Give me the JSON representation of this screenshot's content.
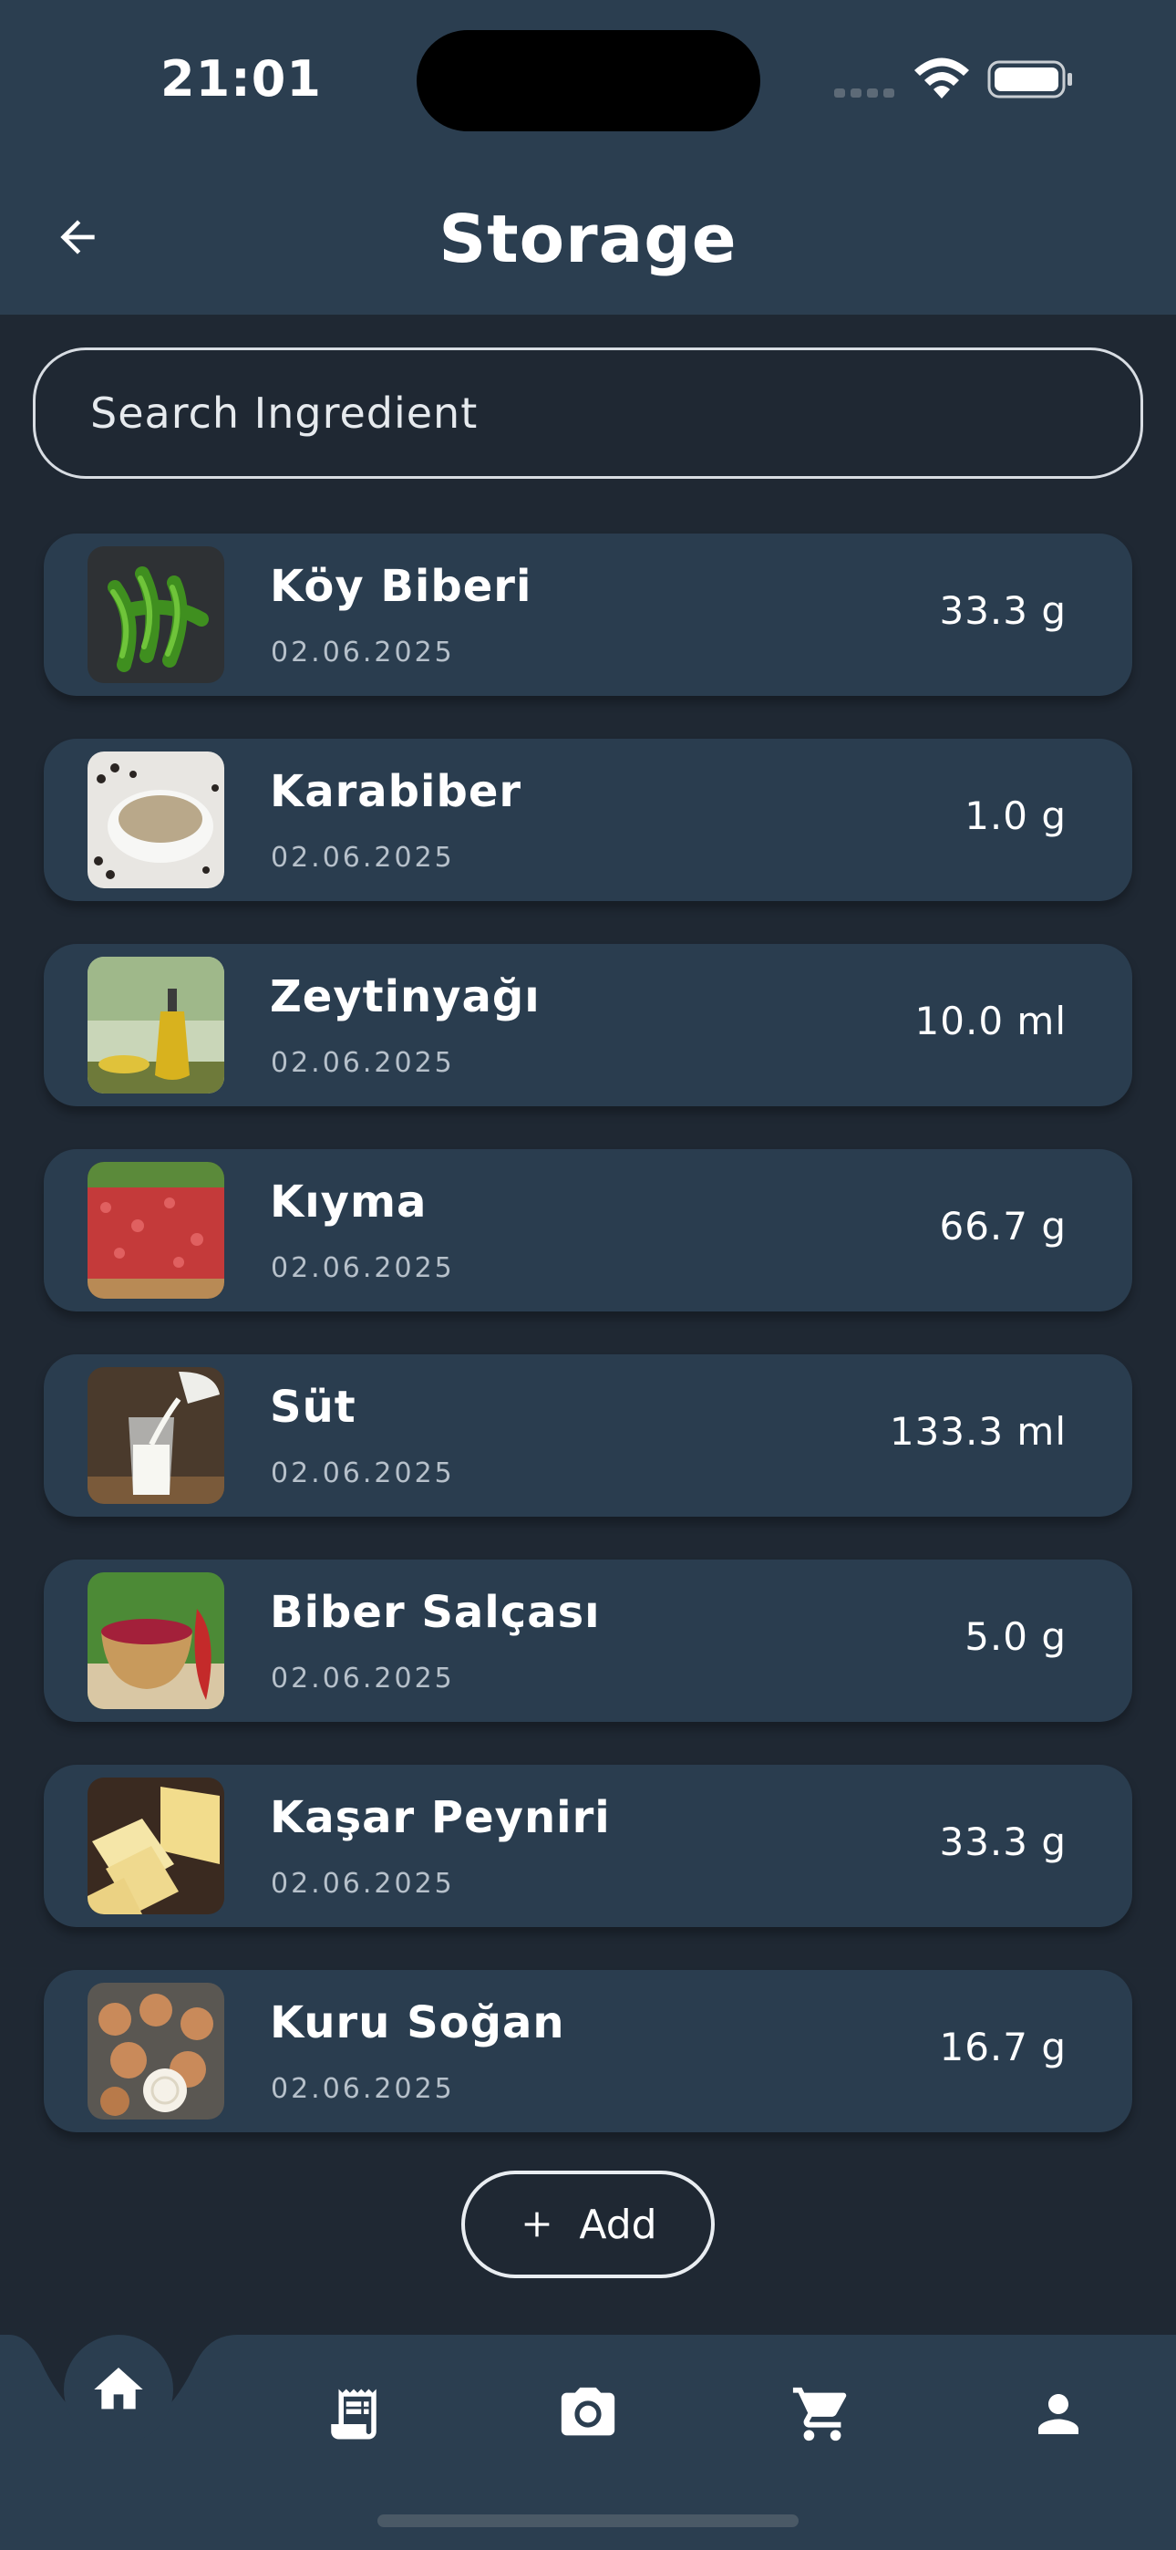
{
  "status_bar": {
    "time": "21:01"
  },
  "header": {
    "title": "Storage",
    "back_icon": "arrow-left-icon"
  },
  "search": {
    "placeholder": "Search Ingredient",
    "value": ""
  },
  "ingredients": [
    {
      "name": "Köy Biberi",
      "date": "02.06.2025",
      "quantity": "33.3 g",
      "image": "green-peppers"
    },
    {
      "name": "Karabiber",
      "date": "02.06.2025",
      "quantity": "1.0 g",
      "image": "black-pepper"
    },
    {
      "name": "Zeytinyağı",
      "date": "02.06.2025",
      "quantity": "10.0 ml",
      "image": "olive-oil"
    },
    {
      "name": "Kıyma",
      "date": "02.06.2025",
      "quantity": "66.7 g",
      "image": "ground-meat"
    },
    {
      "name": "Süt",
      "date": "02.06.2025",
      "quantity": "133.3 ml",
      "image": "milk"
    },
    {
      "name": "Biber Salçası",
      "date": "02.06.2025",
      "quantity": "5.0 g",
      "image": "pepper-paste"
    },
    {
      "name": "Kaşar Peyniri",
      "date": "02.06.2025",
      "quantity": "33.3 g",
      "image": "cheese"
    },
    {
      "name": "Kuru Soğan",
      "date": "02.06.2025",
      "quantity": "16.7 g",
      "image": "onions"
    }
  ],
  "add_button": {
    "label": "Add",
    "icon": "plus-icon"
  },
  "bottom_nav": [
    {
      "icon": "home-icon",
      "active": true
    },
    {
      "icon": "receipt-icon",
      "active": false
    },
    {
      "icon": "camera-icon",
      "active": false
    },
    {
      "icon": "cart-icon",
      "active": false
    },
    {
      "icon": "person-icon",
      "active": false
    }
  ],
  "colors": {
    "background": "#1f2833",
    "header": "#2b3e50",
    "card": "#2a3d4f",
    "text": "#ffffff",
    "subtext": "#b6c0ca"
  }
}
